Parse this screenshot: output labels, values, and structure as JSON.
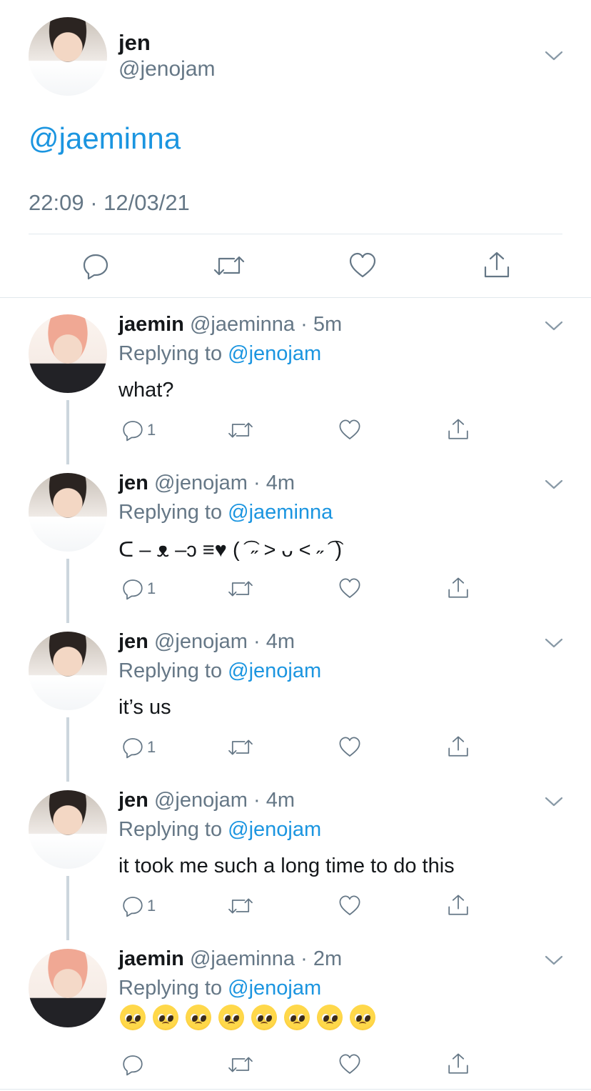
{
  "main_tweet": {
    "author_name": "jen",
    "author_handle": "@jenojam",
    "text": "@jaeminna",
    "timestamp": "22:09 · 12/03/21"
  },
  "replies": [
    {
      "author_name": "jaemin",
      "meta": "@jaeminna · 5m",
      "replying_label": "Replying to",
      "replying_to": "@jenojam",
      "text": "what?",
      "reply_count": "1",
      "avatar": "jaemin"
    },
    {
      "author_name": "jen",
      "meta": "@jenojam · 4m",
      "replying_label": "Replying to",
      "replying_to": "@jaeminna",
      "text": "ᑕ – ᴥ –ↄ  ≡♥  ( ͡ ˶ ˃ ᴗ ˂ ˶ ͡ )",
      "reply_count": "1",
      "avatar": "jen"
    },
    {
      "author_name": "jen",
      "meta": "@jenojam · 4m",
      "replying_label": "Replying to",
      "replying_to": "@jenojam",
      "text": "it’s us",
      "reply_count": "1",
      "avatar": "jen"
    },
    {
      "author_name": "jen",
      "meta": "@jenojam · 4m",
      "replying_label": "Replying to",
      "replying_to": "@jenojam",
      "text": "it took me such a long time to do this",
      "reply_count": "1",
      "avatar": "jen"
    },
    {
      "author_name": "jaemin",
      "meta": "@jaeminna · 2m",
      "replying_label": "Replying to",
      "replying_to": "@jenojam",
      "text": "",
      "emoji_count": 8,
      "emoji_name": "pleading-face-emoji",
      "reply_count": "",
      "avatar": "jaemin"
    }
  ],
  "icons": {
    "reply": "speech-bubble-icon",
    "retweet": "retweet-icon",
    "like": "heart-icon",
    "share": "share-icon",
    "more": "chevron-down-icon"
  },
  "colors": {
    "link": "#1b95e0",
    "secondary_text": "#657786",
    "primary_text": "#14171a",
    "divider": "#e1e8ed"
  }
}
